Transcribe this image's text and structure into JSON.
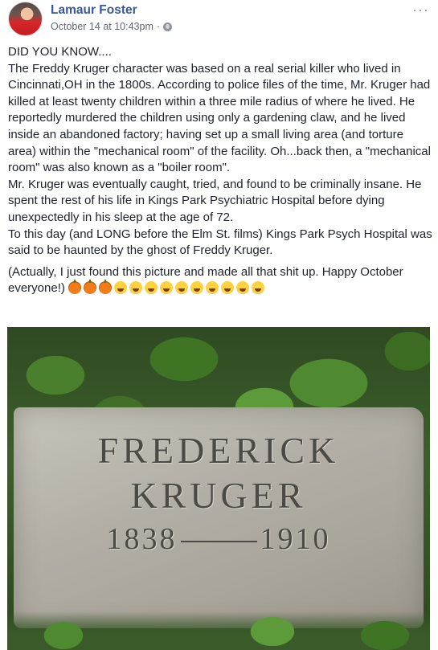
{
  "post": {
    "author": "Lamaur Foster",
    "timestamp": "October 14 at 10:43pm",
    "separator": "·",
    "privacy_icon": "globe-icon",
    "more_label": "···",
    "paragraphs": [
      "DID YOU KNOW....",
      "The Freddy Kruger character was based on a real serial killer who lived in Cincinnati,OH in the 1800s. According to police files of the time, Mr. Kruger had killed at least twenty children within a three mile radius of where he lived. He reportedly murdered the children using only a gardening claw, and he lived inside an abandoned factory; having set up a small living area (and torture area) within the \"mechanical room\" of the facility. Oh...back then, a \"mechanical room\" was also known as a \"boiler room\".",
      "Mr. Kruger was eventually caught, tried, and found to be criminally insane. He spent the rest of his life in Kings Park Psychiatric Hospital before dying unexpectedly in his sleep at the age of 72.",
      "To this day (and LONG before the Elm St. films) Kings Park Psych Hospital was said to be haunted by the ghost of Freddy Kruger."
    ],
    "closing": "(Actually, I just found this picture and made all that shit up. Happy October everyone!)",
    "emojis": [
      "pumpkin",
      "pumpkin",
      "pumpkin",
      "laugh",
      "laugh",
      "laugh",
      "laugh",
      "laugh",
      "laugh",
      "laugh",
      "laugh",
      "laugh",
      "laugh"
    ]
  },
  "photo": {
    "line1": "FREDERICK",
    "line2": "KRUGER",
    "birth": "1838",
    "death": "1910"
  }
}
